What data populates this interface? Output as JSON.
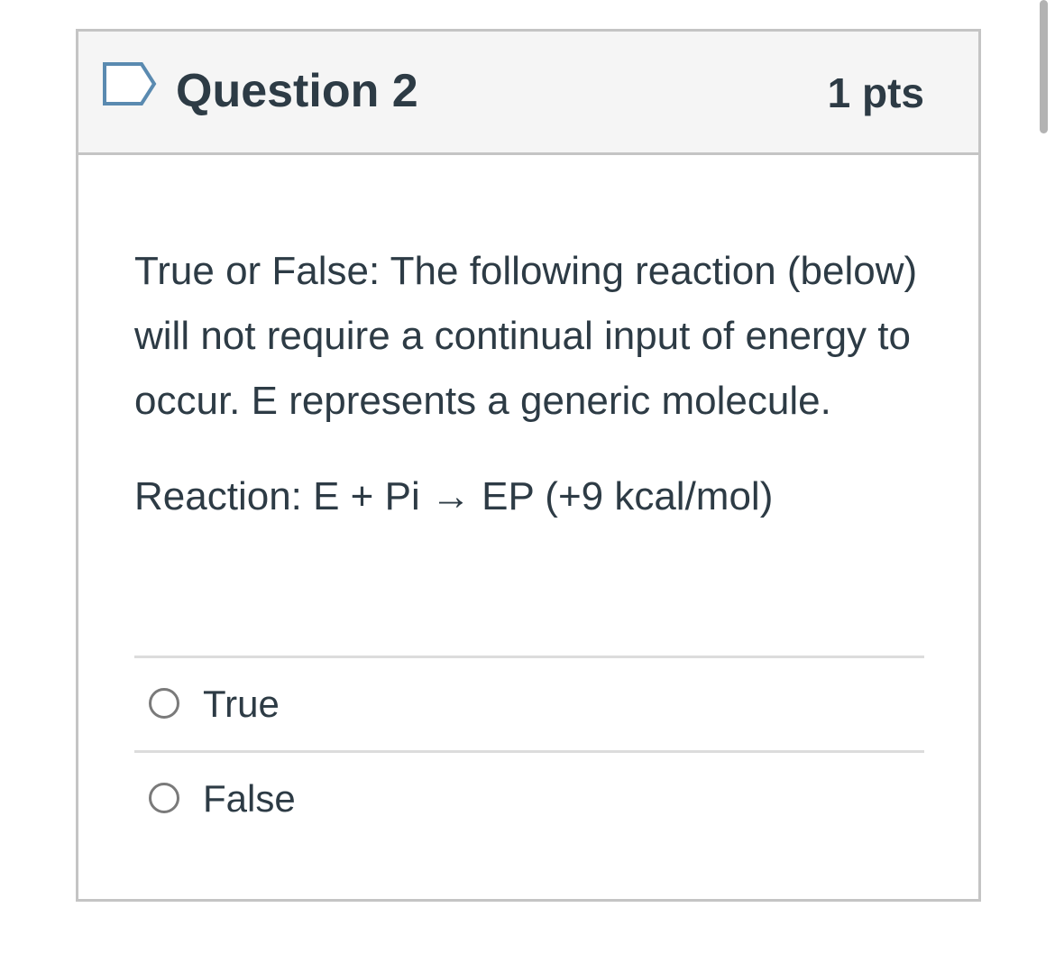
{
  "question": {
    "title": "Question 2",
    "points": "1 pts",
    "flag_icon": "flag-outline-icon",
    "text": "True or False: The following reaction (below) will not require a continual input of energy to occur.  E represents a generic molecule.",
    "reaction": "Reaction: E + Pi → EP (+9 kcal/mol)",
    "answers": [
      {
        "label": "True",
        "selected": false
      },
      {
        "label": "False",
        "selected": false
      }
    ]
  },
  "colors": {
    "text": "#2d3b45",
    "header_bg": "#f5f5f5",
    "border": "#c4c4c4",
    "flag": "#5a8ab0"
  }
}
